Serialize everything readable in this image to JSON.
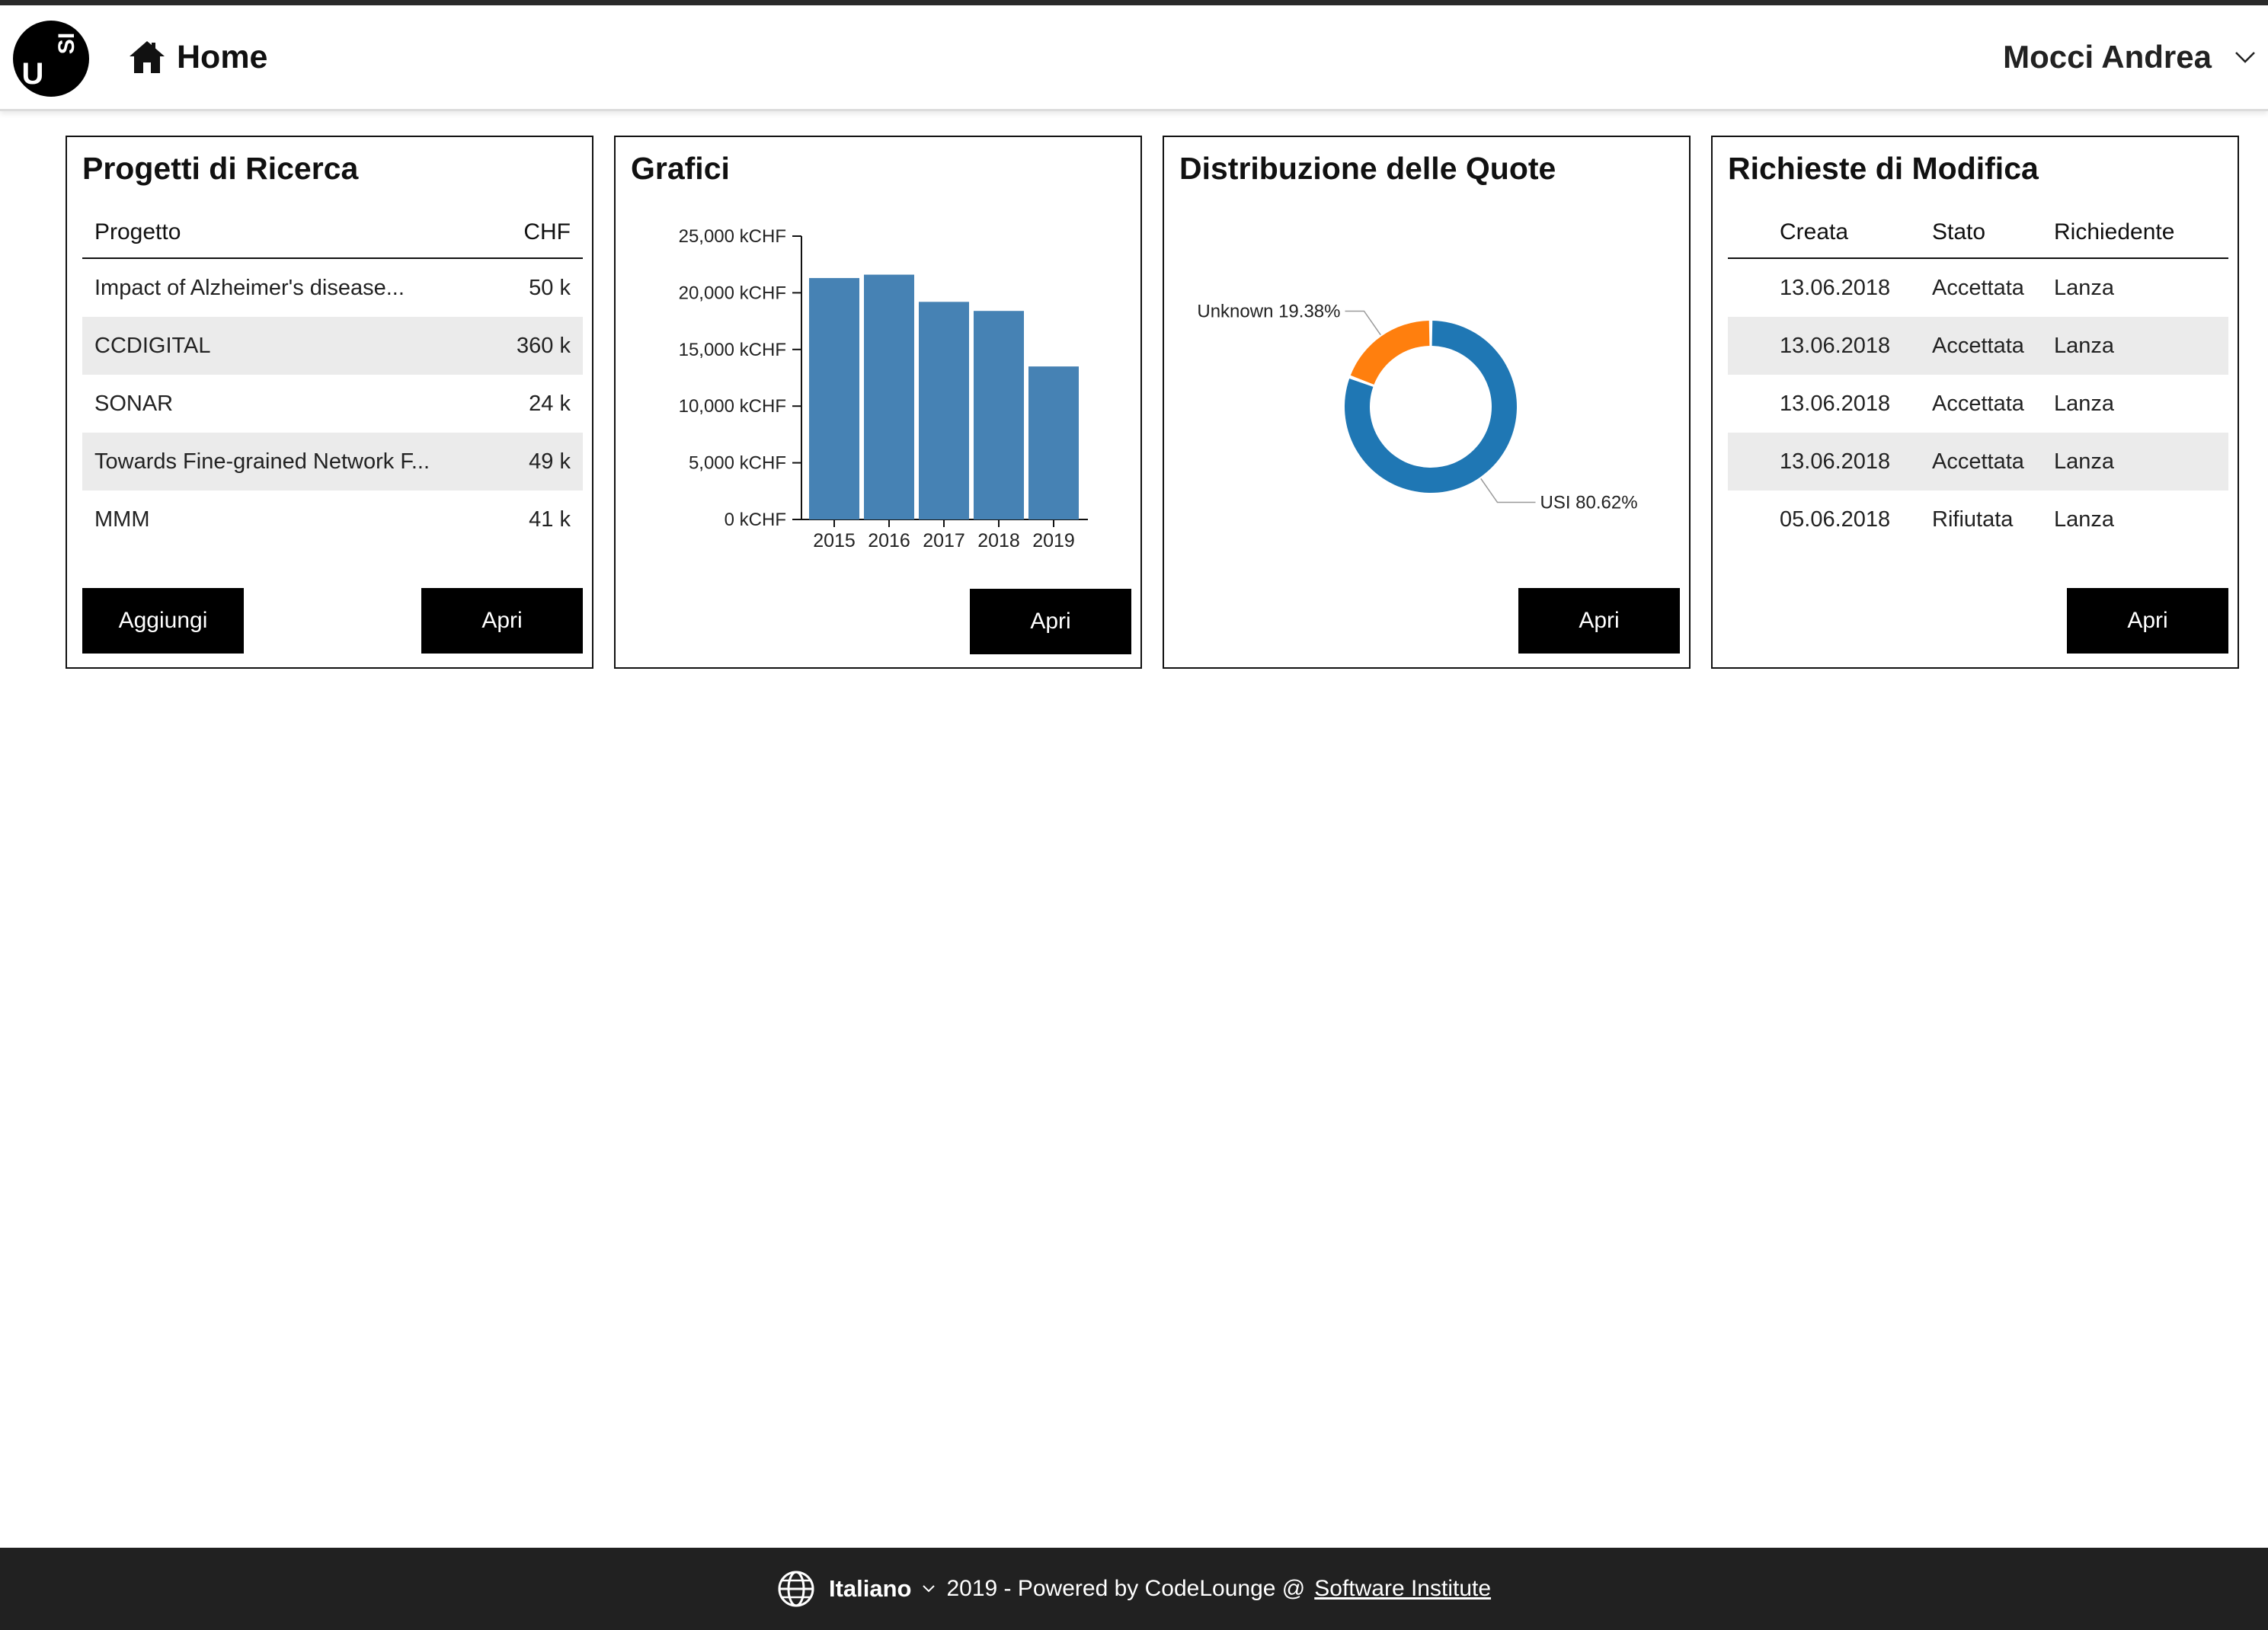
{
  "header": {
    "logo_text": "USI",
    "home_label": "Home",
    "user_name": "Mocci Andrea"
  },
  "projects": {
    "title": "Progetti di Ricerca",
    "columns": [
      "Progetto",
      "CHF"
    ],
    "rows": [
      {
        "name": "Impact of Alzheimer's disease...",
        "chf": "50 k"
      },
      {
        "name": "CCDIGITAL",
        "chf": "360 k"
      },
      {
        "name": "SONAR",
        "chf": "24 k"
      },
      {
        "name": "Towards Fine-grained Network F...",
        "chf": "49 k"
      },
      {
        "name": "MMM",
        "chf": "41 k"
      }
    ],
    "add_label": "Aggiungi",
    "open_label": "Apri"
  },
  "charts": {
    "title": "Grafici",
    "open_label": "Apri"
  },
  "quotes": {
    "title": "Distribuzione delle Quote",
    "open_label": "Apri"
  },
  "requests": {
    "title": "Richieste di Modifica",
    "columns": [
      "Creata",
      "Stato",
      "Richiedente"
    ],
    "rows": [
      {
        "created": "13.06.2018",
        "status": "Accettata",
        "requester": "Lanza"
      },
      {
        "created": "13.06.2018",
        "status": "Accettata",
        "requester": "Lanza"
      },
      {
        "created": "13.06.2018",
        "status": "Accettata",
        "requester": "Lanza"
      },
      {
        "created": "13.06.2018",
        "status": "Accettata",
        "requester": "Lanza"
      },
      {
        "created": "05.06.2018",
        "status": "Rifiutata",
        "requester": "Lanza"
      }
    ],
    "open_label": "Apri"
  },
  "chart_data": [
    {
      "type": "bar",
      "title": "",
      "categories": [
        "2015",
        "2016",
        "2017",
        "2018",
        "2019"
      ],
      "values": [
        21300,
        21600,
        19200,
        18400,
        13500
      ],
      "ylim": [
        0,
        25000
      ],
      "yticks": [
        0,
        5000,
        10000,
        15000,
        20000,
        25000
      ],
      "ytick_labels": [
        "0 kCHF",
        "5,000 kCHF",
        "10,000 kCHF",
        "15,000 kCHF",
        "20,000 kCHF",
        "25,000 kCHF"
      ],
      "color": "#4682b4"
    },
    {
      "type": "pie",
      "title": "",
      "labels": [
        "USI",
        "Unknown"
      ],
      "values": [
        80.62,
        19.38
      ],
      "display_labels": [
        "USI 80.62%",
        "Unknown 19.38%"
      ],
      "colors": [
        "#1f77b4",
        "#ff7f0e"
      ]
    }
  ],
  "footer": {
    "language": "Italiano",
    "text": "2019 - Powered by CodeLounge @",
    "link": "Software Institute"
  }
}
